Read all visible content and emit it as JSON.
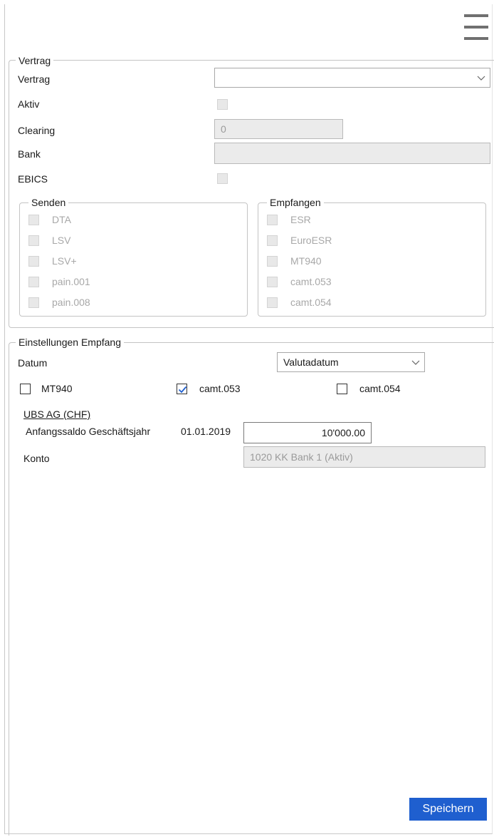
{
  "menu": {
    "icon": "hamburger-menu-icon"
  },
  "vertrag_group": {
    "legend": "Vertrag",
    "vertrag_label": "Vertrag",
    "vertrag_value": "",
    "aktiv_label": "Aktiv",
    "clearing_label": "Clearing",
    "clearing_value": "0",
    "bank_label": "Bank",
    "bank_value": "",
    "ebics_label": "EBICS"
  },
  "senden_group": {
    "legend": "Senden",
    "items": [
      "DTA",
      "LSV",
      "LSV+",
      "pain.001",
      "pain.008"
    ]
  },
  "empfangen_group": {
    "legend": "Empfangen",
    "items": [
      "ESR",
      "EuroESR",
      "MT940",
      "camt.053",
      "camt.054"
    ]
  },
  "einstellungen": {
    "legend": "Einstellungen Empfang",
    "datum_label": "Datum",
    "datum_value": "Valutadatum",
    "formats": [
      {
        "label": "MT940",
        "checked": false
      },
      {
        "label": "camt.053",
        "checked": true
      },
      {
        "label": "camt.054",
        "checked": false
      }
    ],
    "bank_account_link": "UBS AG (CHF)",
    "anfangssaldo_label": "Anfangssaldo Geschäftsjahr",
    "anfangssaldo_date": "01.01.2019",
    "anfangssaldo_value": "10'000.00",
    "konto_label": "Konto",
    "konto_value": "1020 KK Bank 1 (Aktiv)"
  },
  "footer": {
    "save_label": "Speichern"
  },
  "colors": {
    "accent": "#1f5fcf",
    "disabled_bg": "#ebebeb",
    "disabled_text": "#a8a8a8",
    "check": "#1f5fcf"
  }
}
